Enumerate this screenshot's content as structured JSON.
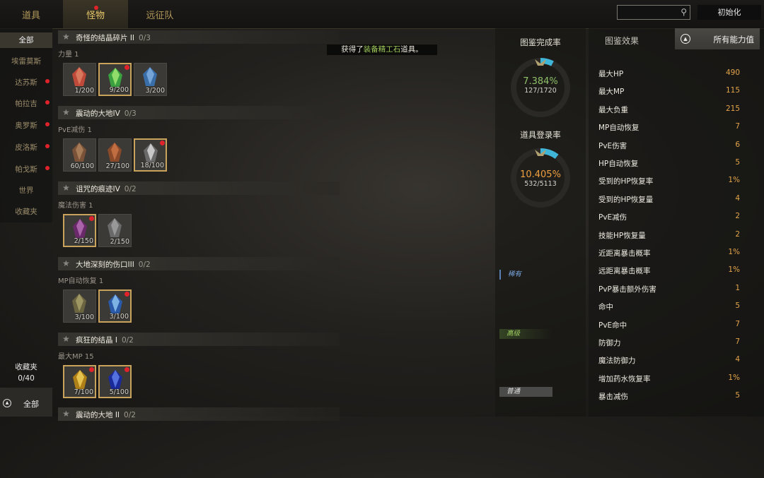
{
  "tabs": [
    {
      "label": "道具"
    },
    {
      "label": "怪物"
    },
    {
      "label": "远征队"
    }
  ],
  "search": {
    "placeholder": ""
  },
  "reset_label": "初始化",
  "sidebar": {
    "items": [
      {
        "label": "全部"
      },
      {
        "label": "埃雷莫斯"
      },
      {
        "label": "达苏斯"
      },
      {
        "label": "帕拉吉"
      },
      {
        "label": "奥罗斯"
      },
      {
        "label": "皮洛斯"
      },
      {
        "label": "帕戈斯"
      },
      {
        "label": "世界"
      },
      {
        "label": "收藏夹"
      }
    ]
  },
  "favorites": {
    "label": "收藏夹",
    "count": "0/40"
  },
  "all_button": "全部",
  "toast": {
    "prefix": "获得了",
    "item": "装备精工石",
    "suffix": "道具。"
  },
  "collections": [
    {
      "title": "奇怪的结晶碎片 II",
      "progress": "0/3",
      "stat": "力量 1",
      "items": [
        {
          "count": "1/200",
          "icon": "crystal-red-icon"
        },
        {
          "count": "9/200",
          "icon": "crystal-green-icon"
        },
        {
          "count": "3/200",
          "icon": "crystal-blue-icon"
        }
      ]
    },
    {
      "title": "震动的大地IV",
      "progress": "0/3",
      "stat": "PvE减伤 1",
      "items": [
        {
          "count": "60/100",
          "icon": "ore-brown-icon"
        },
        {
          "count": "27/100",
          "icon": "ore-rust-icon"
        },
        {
          "count": "18/100",
          "icon": "ore-silver-icon"
        }
      ]
    },
    {
      "title": "诅咒的痕迹IV",
      "progress": "0/2",
      "stat": "魔法伤害 1",
      "items": [
        {
          "count": "2/150",
          "icon": "shard-purple-icon"
        },
        {
          "count": "2/150",
          "icon": "shard-grey-icon"
        }
      ]
    },
    {
      "title": "大地深刻的伤口III",
      "progress": "0/2",
      "stat": "MP自动恢复 1",
      "items": [
        {
          "count": "3/100",
          "icon": "crystal-olive-icon"
        },
        {
          "count": "3/100",
          "icon": "crystal-ice-icon"
        }
      ]
    },
    {
      "title": "疯狂的结晶 I",
      "progress": "0/2",
      "stat": "最大MP 15",
      "items": [
        {
          "count": "7/100",
          "icon": "crystal-gold-icon"
        },
        {
          "count": "5/100",
          "icon": "crystal-sapphire-icon"
        }
      ]
    },
    {
      "title": "震动的大地 II",
      "progress": "0/2",
      "stat": "",
      "items": []
    }
  ],
  "completion": {
    "title": "图鉴完成率",
    "percent": "7.384%",
    "value": 7.384,
    "counts": "127/1720"
  },
  "registration": {
    "title": "道具登录率",
    "percent": "10.405%",
    "value": 10.405,
    "counts": "532/5113"
  },
  "tiers": [
    {
      "label": "稀有"
    },
    {
      "label": "高级"
    },
    {
      "label": "普通"
    }
  ],
  "effects": {
    "title": "图鉴效果",
    "all_stats_button": "所有能力值",
    "stats": [
      {
        "name": "最大HP",
        "value": "490"
      },
      {
        "name": "最大MP",
        "value": "115"
      },
      {
        "name": "最大负重",
        "value": "215"
      },
      {
        "name": "MP自动恢复",
        "value": "7"
      },
      {
        "name": "PvE伤害",
        "value": "6"
      },
      {
        "name": "HP自动恢复",
        "value": "5"
      },
      {
        "name": "受到的HP恢复率",
        "value": "1%"
      },
      {
        "name": "受到的HP恢复量",
        "value": "4"
      },
      {
        "name": "PvE减伤",
        "value": "2"
      },
      {
        "name": "技能HP恢复量",
        "value": "2"
      },
      {
        "name": "近距离暴击概率",
        "value": "1%"
      },
      {
        "name": "远距离暴击概率",
        "value": "1%"
      },
      {
        "name": "PvP暴击额外伤害",
        "value": "1"
      },
      {
        "name": "命中",
        "value": "5"
      },
      {
        "name": "PvE命中",
        "value": "7"
      },
      {
        "name": "防御力",
        "value": "7"
      },
      {
        "name": "魔法防御力",
        "value": "4"
      },
      {
        "name": "增加药水恢复率",
        "value": "1%"
      },
      {
        "name": "暴击减伤",
        "value": "5"
      }
    ]
  },
  "colors": {
    "accent": "#e8c86a",
    "value": "#e3a54a",
    "badge": "#e0232a",
    "completion_pct": "#8fc06a",
    "registration_pct": "#f0a040",
    "ring_fill": "#3fb6d8"
  }
}
